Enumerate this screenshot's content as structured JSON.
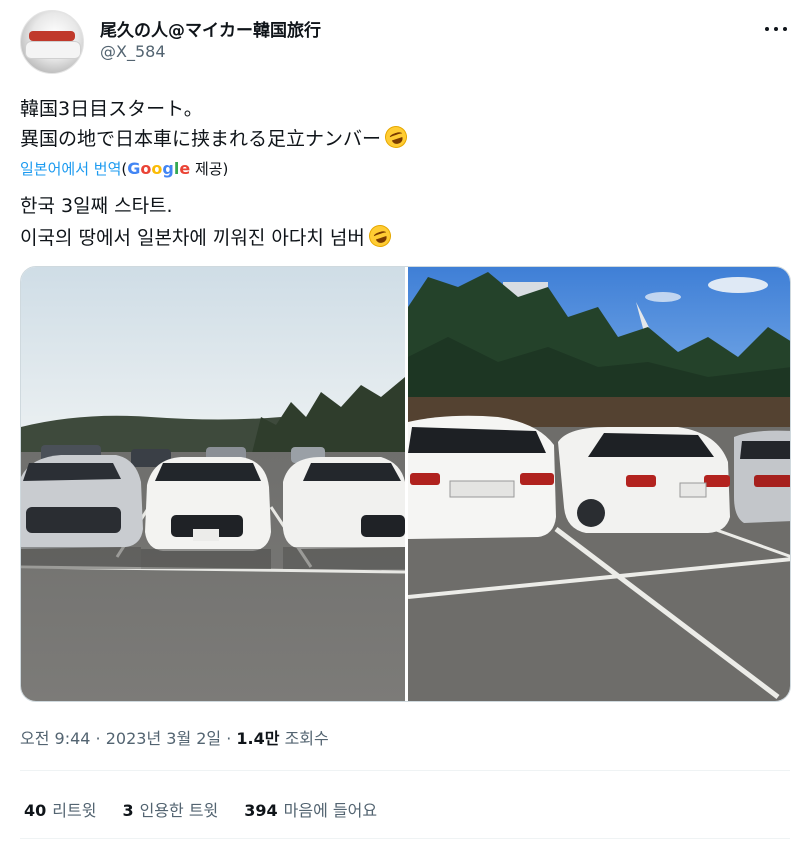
{
  "author": {
    "display_name": "尾久の人@マイカー韓国旅行",
    "handle": "@X_584"
  },
  "tweet": {
    "line1": "韓国3日目スタート。",
    "line2": "異国の地で日本車に挟まれる足立ナンバー"
  },
  "translation": {
    "link_label": "일본어에서 번역",
    "open_paren": "(",
    "google_letters": [
      {
        "ch": "G",
        "color": "#4285F4"
      },
      {
        "ch": "o",
        "color": "#EA4335"
      },
      {
        "ch": "o",
        "color": "#FBBC05"
      },
      {
        "ch": "g",
        "color": "#4285F4"
      },
      {
        "ch": "l",
        "color": "#34A853"
      },
      {
        "ch": "e",
        "color": "#EA4335"
      }
    ],
    "provided_suffix": " 제공)",
    "line1": "한국 3일째 스타트.",
    "line2": "이국의 땅에서 일본차에 끼워진 아다치 넘버"
  },
  "meta": {
    "time": "오전 9:44",
    "sep1": " · ",
    "date": "2023년 3월 2일",
    "sep2": " · ",
    "views_count": "1.4만",
    "views_label": " 조회수"
  },
  "stats": {
    "retweets_count": "40",
    "retweets_label": "리트윗",
    "quotes_count": "3",
    "quotes_label": "인용한 트윗",
    "likes_count": "394",
    "likes_label": "마음에 들어요"
  },
  "colors": {
    "link_blue": "#1d9bf0",
    "text_main": "#0f1419",
    "text_secondary": "#536471"
  },
  "icons": {
    "emoji": "rolling-on-floor-laughing-emoji",
    "more": "more-horizontal-icon"
  }
}
